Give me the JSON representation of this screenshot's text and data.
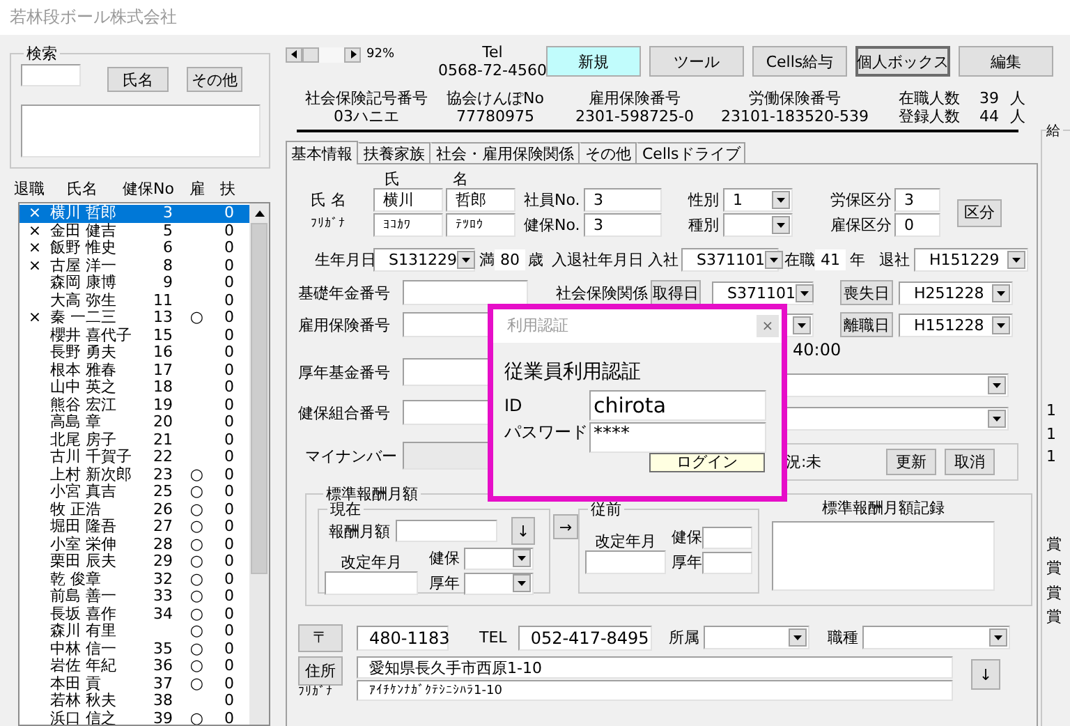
{
  "window": {
    "title": "若林段ボール株式会社"
  },
  "search": {
    "label": "検索",
    "buttons": [
      "氏名",
      "その他"
    ]
  },
  "employee_list": {
    "columns": [
      "退職",
      "氏名",
      "健保No",
      "雇",
      "扶"
    ],
    "rows": [
      {
        "retired": "×",
        "name": "横川 哲郎",
        "health_no": "3",
        "dependents": "0",
        "selected": true
      },
      {
        "retired": "×",
        "name": "金田 健吉",
        "health_no": "5",
        "dependents": "0",
        "selected": false
      },
      {
        "retired": "×",
        "name": "飯野 惟史",
        "health_no": "6",
        "dependents": "0",
        "selected": false
      },
      {
        "retired": "×",
        "name": "古屋 洋一",
        "health_no": "8",
        "dependents": "0",
        "selected": false
      },
      {
        "name": "森岡 康博",
        "health_no": "9",
        "dependents": "0",
        "selected": false
      },
      {
        "name": "大高 弥生",
        "health_no": "11",
        "dependents": "0",
        "selected": false
      },
      {
        "retired": "×",
        "name": "秦 一二三",
        "health_no": "13",
        "employment": "○",
        "dependents": "0",
        "selected": false
      },
      {
        "name": "櫻井 喜代子",
        "health_no": "15",
        "dependents": "0",
        "selected": false
      },
      {
        "name": "長野 勇夫",
        "health_no": "16",
        "dependents": "0",
        "selected": false
      },
      {
        "name": "根本 雅春",
        "health_no": "17",
        "dependents": "0",
        "selected": false
      },
      {
        "name": "山中 英之",
        "health_no": "18",
        "dependents": "0",
        "selected": false
      },
      {
        "name": "熊谷 宏江",
        "health_no": "19",
        "dependents": "0",
        "selected": false
      },
      {
        "name": "高島 章",
        "health_no": "20",
        "dependents": "0",
        "selected": false
      },
      {
        "name": "北尾 房子",
        "health_no": "21",
        "dependents": "0",
        "selected": false
      },
      {
        "name": "古川 千賀子",
        "health_no": "22",
        "dependents": "0",
        "selected": false
      },
      {
        "name": "上村 新次郎",
        "health_no": "23",
        "employment": "○",
        "dependents": "0",
        "selected": false
      },
      {
        "name": "小宮 真吉",
        "health_no": "25",
        "employment": "○",
        "dependents": "0",
        "selected": false
      },
      {
        "name": "牧 正浩",
        "health_no": "26",
        "employment": "○",
        "dependents": "0",
        "selected": false
      },
      {
        "name": "堀田 隆吾",
        "health_no": "27",
        "employment": "○",
        "dependents": "0",
        "selected": false
      },
      {
        "name": "小室 栄伸",
        "health_no": "28",
        "employment": "○",
        "dependents": "0",
        "selected": false
      },
      {
        "name": "栗田 辰夫",
        "health_no": "29",
        "employment": "○",
        "dependents": "0",
        "selected": false
      },
      {
        "name": "乾 俊章",
        "health_no": "32",
        "employment": "○",
        "dependents": "0",
        "selected": false
      },
      {
        "name": "前島 善一",
        "health_no": "33",
        "employment": "○",
        "dependents": "0",
        "selected": false
      },
      {
        "name": "長坂 喜作",
        "health_no": "34",
        "employment": "○",
        "dependents": "0",
        "selected": false
      },
      {
        "name": "森川 有里",
        "employment": "○",
        "dependents": "0",
        "selected": false
      },
      {
        "name": "中林 信一",
        "health_no": "35",
        "employment": "○",
        "dependents": "0",
        "selected": false
      },
      {
        "name": "岩佐 年紀",
        "health_no": "36",
        "employment": "○",
        "dependents": "0",
        "selected": false
      },
      {
        "name": "本田 貢",
        "health_no": "37",
        "employment": "○",
        "dependents": "0",
        "selected": false
      },
      {
        "name": "若林 秋夫",
        "health_no": "38",
        "dependents": "0",
        "selected": false
      },
      {
        "name": "浜口 信之",
        "health_no": "39",
        "employment": "○",
        "dependents": "0",
        "selected": false
      }
    ]
  },
  "toolbar": {
    "zoom": "92%",
    "tel_label": "Tel",
    "tel": "0568-72-4560",
    "buttons": [
      {
        "label": "新規",
        "kind": "highlight"
      },
      {
        "label": "ツール",
        "kind": "plain"
      },
      {
        "label": "Cells給与",
        "kind": "plain"
      },
      {
        "label": "個人ボックス",
        "kind": "focused"
      },
      {
        "label": "編集",
        "kind": "plain"
      }
    ]
  },
  "company_info": [
    {
      "label": "社会保険記号番号",
      "value": "03ハニエ"
    },
    {
      "label": "協会けんぽNo",
      "value": "77780975"
    },
    {
      "label": "雇用保険番号",
      "value": "2301-598725-0"
    },
    {
      "label": "労働保険番号",
      "value": "23101-183520-539"
    }
  ],
  "headcount": [
    {
      "label": "在職人数",
      "value": "39",
      "unit": "人"
    },
    {
      "label": "登録人数",
      "value": "44",
      "unit": "人"
    }
  ],
  "tabs": [
    {
      "label": "基本情報",
      "selected": true
    },
    {
      "label": "扶養家族",
      "selected": false
    },
    {
      "label": "社会・雇用保険関係",
      "selected": false
    },
    {
      "label": "その他",
      "selected": false
    },
    {
      "label": "Cellsドライブ",
      "selected": false
    }
  ],
  "name_section": {
    "family_heading": "氏",
    "given_heading": "名",
    "name_label": "氏 名",
    "family": "横川",
    "given": "哲郎",
    "kana_label": "ﾌﾘｶﾞﾅ",
    "family_kana": "ﾖｺｶﾜ",
    "given_kana": "ﾃﾂﾛｳ"
  },
  "ids": {
    "employee_no_label": "社員No.",
    "employee_no": "3",
    "health_no_label": "健保No.",
    "health_no": "3"
  },
  "classes": {
    "gender_label": "性別",
    "gender": "1",
    "category_label": "種別",
    "labor_label": "労保区分",
    "labor": "3",
    "employment_label": "雇保区分",
    "employment": "0",
    "button": "区分"
  },
  "dates": {
    "birth_label": "生年月日",
    "birth": "S131229",
    "age_prefix": "満",
    "age": "80",
    "age_unit": "歳",
    "join_label": "入退社年月日",
    "enter_label": "入社",
    "enter": "S371101",
    "tenure_prefix": "在職",
    "tenure": "41",
    "tenure_unit": "年",
    "leave_label": "退社",
    "leave": "H151229"
  },
  "numbers": [
    {
      "label": "基礎年金番号",
      "disabled": false
    },
    {
      "label": "雇用保険番号",
      "disabled": false
    },
    {
      "label": "厚年基金番号",
      "disabled": false
    },
    {
      "label": "健保組合番号",
      "disabled": false
    },
    {
      "label": "マイナンバー",
      "disabled": true
    }
  ],
  "social_insurance": {
    "label": "社会保険関係",
    "acquired_button": "取得日",
    "acquired": "S371101",
    "lost_button": "喪失日",
    "lost": "H251228",
    "separation_button": "離職日",
    "separation": "H151228",
    "time": "40:00",
    "status": "況:未",
    "buttons": [
      "更新",
      "取消"
    ]
  },
  "standard_pay": {
    "title": "標準報酬月額",
    "current": {
      "title": "現在",
      "pay_label": "報酬月額",
      "down": "↓",
      "revision_label": "改定年月",
      "health_label": "健保",
      "pension_label": "厚年"
    },
    "arrow": "→",
    "previous": {
      "title": "従前",
      "revision_label": "改定年月",
      "health_label": "健保",
      "pension_label": "厚年"
    },
    "record_title": "標準報酬月額記録"
  },
  "contact": {
    "postal_button": "〒",
    "postal": "480-1183",
    "tel_label": "TEL",
    "tel": "052-417-8495",
    "dept_label": "所属",
    "job_label": "職種",
    "address_button": "住所",
    "address": "愛知県長久手市西原1-10",
    "kana_label": "ﾌﾘｶﾞﾅ",
    "address_kana": "ｱｲﾁｹﾝﾅｶﾞｸﾃｼﾆｼﾊﾗ1-10",
    "down": "↓"
  },
  "side_panel": {
    "title": "給",
    "texts": [
      "1",
      "1",
      "1"
    ],
    "texts_2": [
      "賞",
      "賞",
      "賞",
      "賞"
    ]
  },
  "dialog": {
    "title": "利用認証",
    "close": "×",
    "heading": "従業員利用認証",
    "id_label": "ID",
    "id": "chirota",
    "password_label": "パスワード",
    "password": "****",
    "login": "ログイン"
  }
}
